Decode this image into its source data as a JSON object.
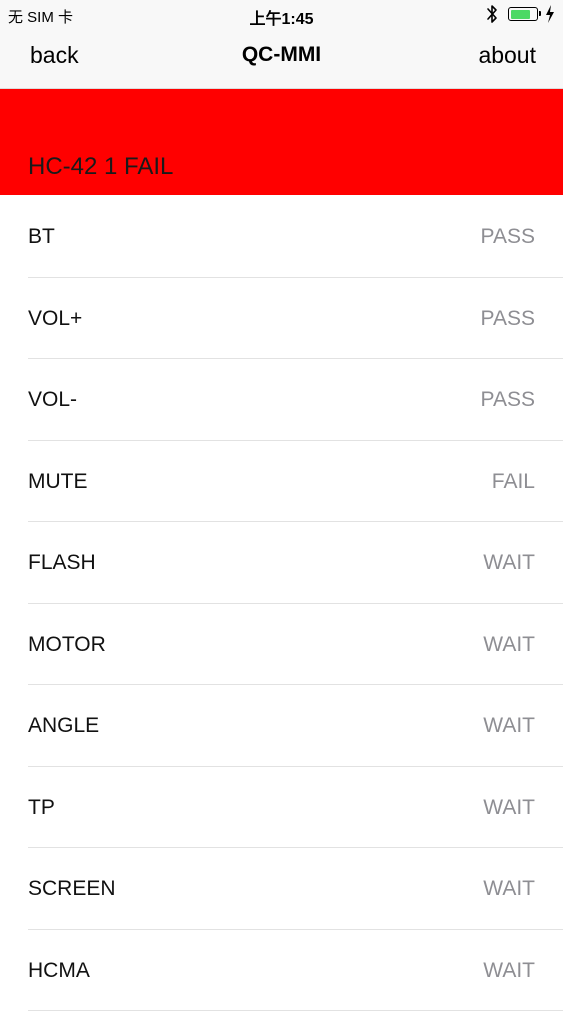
{
  "status_bar": {
    "carrier": "无 SIM 卡",
    "time": "上午1:45",
    "battery_level": 0.78,
    "battery_color": "#4cd964"
  },
  "nav": {
    "back_label": "back",
    "title": "QC-MMI",
    "about_label": "about"
  },
  "result": {
    "text": "HC-42 1 FAIL",
    "background": "#ff0000"
  },
  "tests": [
    {
      "name": "BT",
      "status": "PASS"
    },
    {
      "name": "VOL+",
      "status": "PASS"
    },
    {
      "name": "VOL-",
      "status": "PASS"
    },
    {
      "name": "MUTE",
      "status": "FAIL"
    },
    {
      "name": "FLASH",
      "status": "WAIT"
    },
    {
      "name": "MOTOR",
      "status": "WAIT"
    },
    {
      "name": "ANGLE",
      "status": "WAIT"
    },
    {
      "name": "TP",
      "status": "WAIT"
    },
    {
      "name": "SCREEN",
      "status": "WAIT"
    },
    {
      "name": "HCMA",
      "status": "WAIT"
    }
  ]
}
